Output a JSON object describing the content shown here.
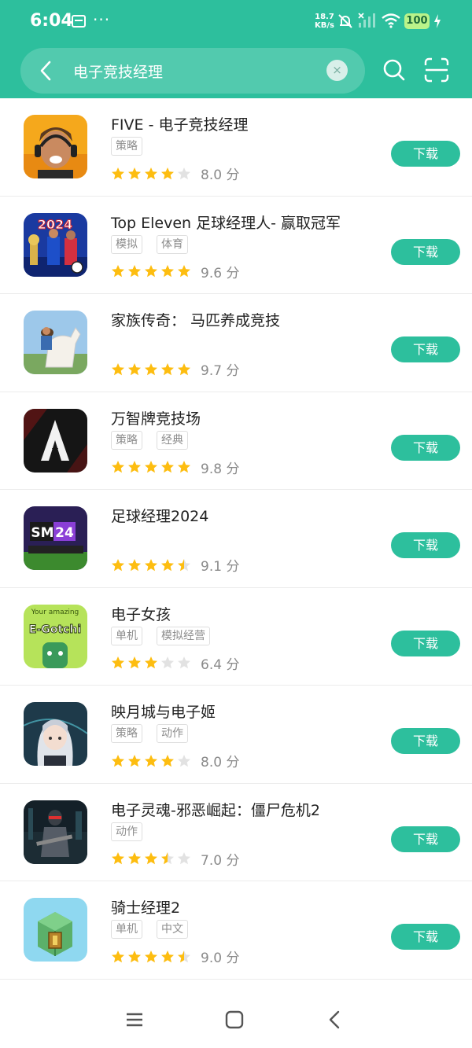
{
  "status_bar": {
    "time": "6:04",
    "dots": "···",
    "speed_value": "18.7",
    "speed_unit": "KB/s",
    "battery": "100"
  },
  "search": {
    "query": "电子竞技经理",
    "clear_icon": "×"
  },
  "download_label": "下载",
  "apps": [
    {
      "name": "FIVE - 电子竞技经理",
      "tags": [
        "策略"
      ],
      "rating": 4,
      "score": "8.0 分"
    },
    {
      "name": "Top Eleven 足球经理人- 赢取冠军",
      "tags": [
        "模拟",
        "体育"
      ],
      "rating": 5,
      "score": "9.6 分"
    },
    {
      "name": "家族传奇： 马匹养成竞技",
      "tags": [],
      "rating": 5,
      "score": "9.7 分"
    },
    {
      "name": "万智牌竞技场",
      "tags": [
        "策略",
        "经典"
      ],
      "rating": 5,
      "score": "9.8 分"
    },
    {
      "name": "足球经理2024",
      "tags": [],
      "rating": 4.5,
      "score": "9.1 分"
    },
    {
      "name": "电子女孩",
      "tags": [
        "单机",
        "模拟经营"
      ],
      "rating": 3,
      "score": "6.4 分"
    },
    {
      "name": "映月城与电子姬",
      "tags": [
        "策略",
        "动作"
      ],
      "rating": 4,
      "score": "8.0 分"
    },
    {
      "name": "电子灵魂-邪恶崛起：僵尸危机2",
      "tags": [
        "动作"
      ],
      "rating": 3.5,
      "score": "7.0 分"
    },
    {
      "name": "骑士经理2",
      "tags": [
        "单机",
        "中文"
      ],
      "rating": 4.5,
      "score": "9.0 分"
    }
  ],
  "icon_texts": {
    "top_eleven": "2024",
    "sm24_a": "SM",
    "sm24_b": "24",
    "egirl_top": "Your amazing",
    "egirl_main": "E-Gotchi"
  },
  "colors": {
    "accent": "#2dbf9d",
    "star": "#fdbd10",
    "star_empty": "#e2e2e2"
  }
}
